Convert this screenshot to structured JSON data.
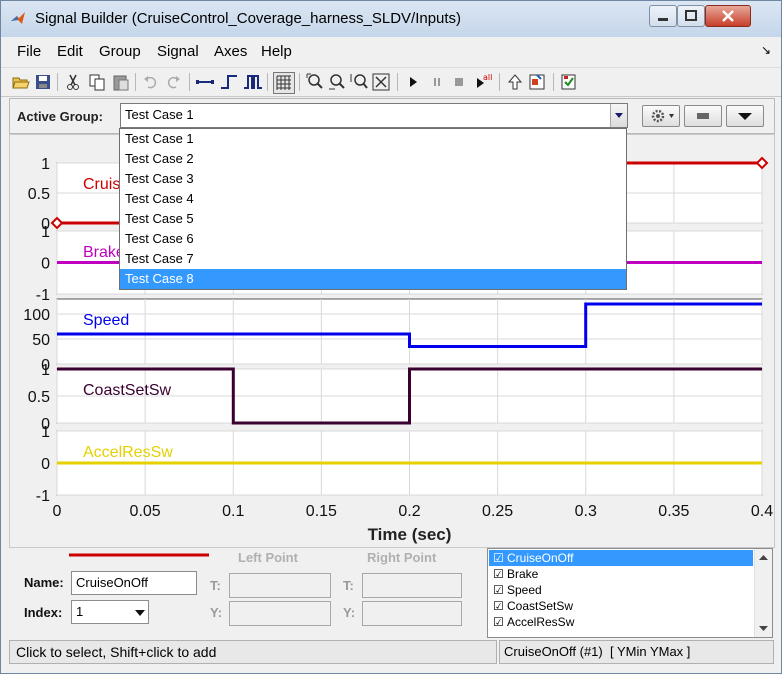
{
  "window": {
    "title": "Signal Builder (CruiseControl_Coverage_harness_SLDV/Inputs)"
  },
  "menu": [
    "File",
    "Edit",
    "Group",
    "Signal",
    "Axes",
    "Help"
  ],
  "toolbar": {
    "icons": [
      "open-icon",
      "save-icon",
      "cut-icon",
      "copy-icon",
      "paste-icon",
      "undo-icon",
      "redo-icon",
      "segment-icon",
      "step-icon",
      "pulse-icon",
      "grid-icon",
      "zoom-xy-icon",
      "zoom-x-icon",
      "zoom-y-icon",
      "fit-icon",
      "play-icon",
      "pause-icon",
      "stop-icon",
      "run-all-icon",
      "up-icon",
      "signal-icon",
      "verify-icon"
    ]
  },
  "group": {
    "label": "Active Group:",
    "selected": "Test Case 1",
    "options": [
      "Test Case 1",
      "Test Case 2",
      "Test Case 3",
      "Test Case 4",
      "Test Case 5",
      "Test Case 6",
      "Test Case 7",
      "Test Case 8"
    ],
    "highlighted_index": 7
  },
  "plot": {
    "xlabel": "Time (sec)",
    "xlim": [
      0,
      0.4
    ],
    "xticks": [
      "0",
      "0.05",
      "0.1",
      "0.15",
      "0.2",
      "0.25",
      "0.3",
      "0.35",
      "0.4"
    ],
    "xtick_values": [
      0,
      0.05,
      0.1,
      0.15,
      0.2,
      0.25,
      0.3,
      0.35,
      0.4
    ],
    "grid": true
  },
  "chart_data": [
    {
      "type": "line",
      "name": "CruiseOnOff",
      "color": "#cc0000",
      "ylim": [
        0,
        1
      ],
      "yticks": [
        "0",
        "0.5",
        "1"
      ],
      "ytick_values": [
        0,
        0.5,
        1
      ],
      "x": [
        0,
        0.2,
        0.2,
        0.4
      ],
      "y": [
        0,
        0,
        1,
        1
      ],
      "selected": true
    },
    {
      "type": "line",
      "name": "Brake",
      "color": "#c000c0",
      "ylim": [
        -1,
        1
      ],
      "yticks": [
        "-1",
        "0",
        "1"
      ],
      "ytick_values": [
        -1,
        0,
        1
      ],
      "x": [
        0,
        0.4
      ],
      "y": [
        0,
        0
      ]
    },
    {
      "type": "line",
      "name": "Speed",
      "color": "#0000ee",
      "ylim": [
        0,
        130
      ],
      "yticks": [
        "0",
        "50",
        "100"
      ],
      "ytick_values": [
        0,
        50,
        100
      ],
      "x": [
        0,
        0.2,
        0.2,
        0.3,
        0.3,
        0.4
      ],
      "y": [
        60,
        60,
        35,
        35,
        120,
        120
      ]
    },
    {
      "type": "line",
      "name": "CoastSetSw",
      "color": "#3a0030",
      "ylim": [
        0,
        1
      ],
      "yticks": [
        "0",
        "0.5",
        "1"
      ],
      "ytick_values": [
        0,
        0.5,
        1
      ],
      "x": [
        0,
        0.1,
        0.1,
        0.2,
        0.2,
        0.4
      ],
      "y": [
        1,
        1,
        0,
        0,
        1,
        1
      ]
    },
    {
      "type": "line",
      "name": "AccelResSw",
      "color": "#e6d000",
      "ylim": [
        -1,
        1
      ],
      "yticks": [
        "-1",
        "0",
        "1"
      ],
      "ytick_values": [
        -1,
        0,
        1
      ],
      "x": [
        0,
        0.4
      ],
      "y": [
        0,
        0
      ]
    }
  ],
  "props": {
    "left_point": "Left Point",
    "right_point": "Right Point",
    "name_label": "Name:",
    "name_value": "CruiseOnOff",
    "index_label": "Index:",
    "index_value": "1",
    "t_label": "T:",
    "y_label": "Y:",
    "line_color": "#cc0000"
  },
  "signal_list": [
    {
      "name": "CruiseOnOff",
      "checked": true,
      "selected": true
    },
    {
      "name": "Brake",
      "checked": true,
      "selected": false
    },
    {
      "name": "Speed",
      "checked": true,
      "selected": false
    },
    {
      "name": "CoastSetSw",
      "checked": true,
      "selected": false
    },
    {
      "name": "AccelResSw",
      "checked": true,
      "selected": false
    }
  ],
  "status": {
    "left": "Click to select, Shift+click to add",
    "right": "CruiseOnOff (#1)  [ YMin YMax ]"
  }
}
